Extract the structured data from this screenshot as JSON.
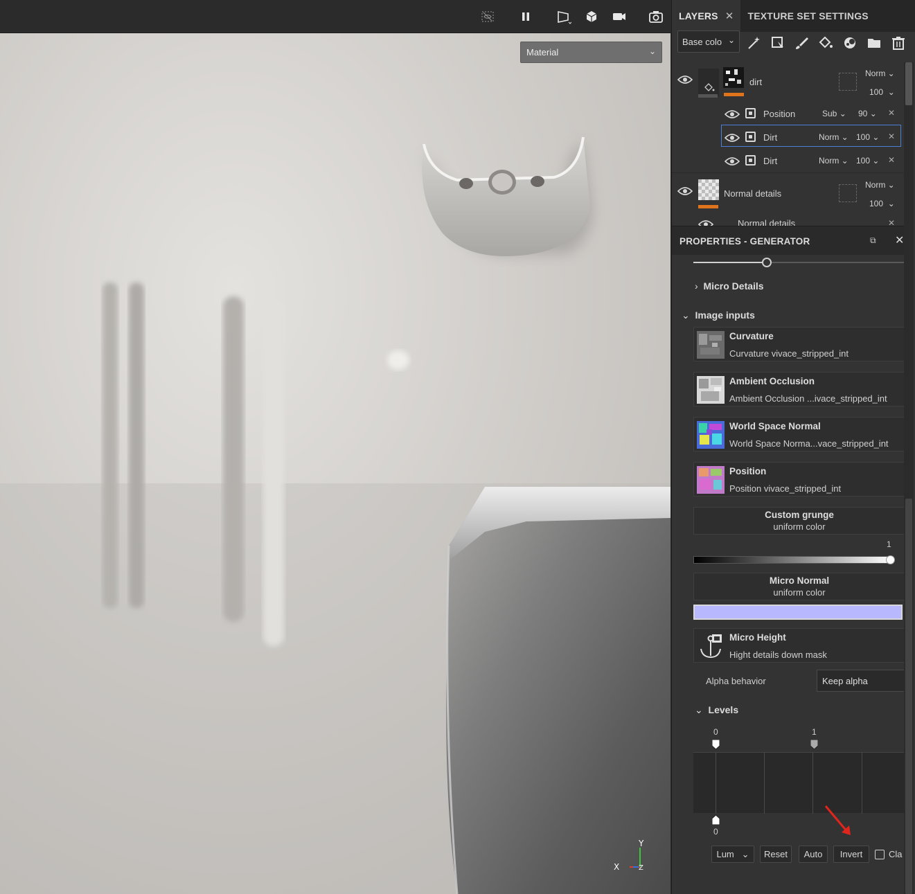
{
  "viewport": {
    "material_select": "Material",
    "axis": {
      "y": "Y",
      "x": "X",
      "z": "Z"
    },
    "toolbar_icons": [
      "hide-icon",
      "pause-icon",
      "perspective-icon",
      "cube-icon",
      "camera-icon",
      "screenshot-icon"
    ]
  },
  "tabs": [
    {
      "label": "LAYERS",
      "close": "✕"
    },
    {
      "label": "TEXTURE SET SETTINGS"
    }
  ],
  "layers_toolbar": {
    "channel": "Base colo",
    "tools": [
      "magic-wand-icon",
      "add-fill-layer-icon",
      "paint-brush-icon",
      "fill-bucket-icon",
      "mask-icon",
      "folder-icon",
      "trash-icon"
    ]
  },
  "layers": [
    {
      "name": "dirt",
      "blend": "Norm",
      "opacity": "100",
      "effects": [
        {
          "name": "Position",
          "blend": "Sub",
          "opacity": "90"
        },
        {
          "name": "Dirt",
          "blend": "Norm",
          "opacity": "100",
          "selected": true
        },
        {
          "name": "Dirt",
          "blend": "Norm",
          "opacity": "100"
        }
      ]
    },
    {
      "name": "Normal details",
      "blend": "Norm",
      "opacity": "100",
      "partial_child": "Normal details"
    }
  ],
  "properties": {
    "title": "PROPERTIES - GENERATOR",
    "micro_details": "Micro Details",
    "image_inputs": "Image inputs",
    "inputs": [
      {
        "name": "Curvature",
        "source": "Curvature vivace_stripped_int"
      },
      {
        "name": "Ambient Occlusion",
        "source": "Ambient Occlusion ...ivace_stripped_int"
      },
      {
        "name": "World Space Normal",
        "source": "World Space Norma...vace_stripped_int"
      },
      {
        "name": "Position",
        "source": "Position vivace_stripped_int"
      }
    ],
    "custom_grunge": {
      "name": "Custom grunge",
      "sub": "uniform color",
      "value_label": "1",
      "value": 1
    },
    "micro_normal": {
      "name": "Micro Normal",
      "sub": "uniform color",
      "color": "#b8b8ff"
    },
    "micro_height": {
      "name": "Micro Height",
      "sub": "Hight details down mask"
    },
    "alpha_behavior": {
      "label": "Alpha behavior",
      "value": "Keep alpha"
    },
    "levels": {
      "title": "Levels",
      "top_left": "0",
      "top_right": "1",
      "bottom_left": "0",
      "channel": "Lum",
      "buttons": [
        "Reset",
        "Auto",
        "Invert"
      ],
      "clamp": "Cla"
    }
  },
  "colors": {
    "accent_orange": "#e0741c",
    "selection_blue": "#4c7fd8",
    "annotation_red": "#e0261c"
  }
}
